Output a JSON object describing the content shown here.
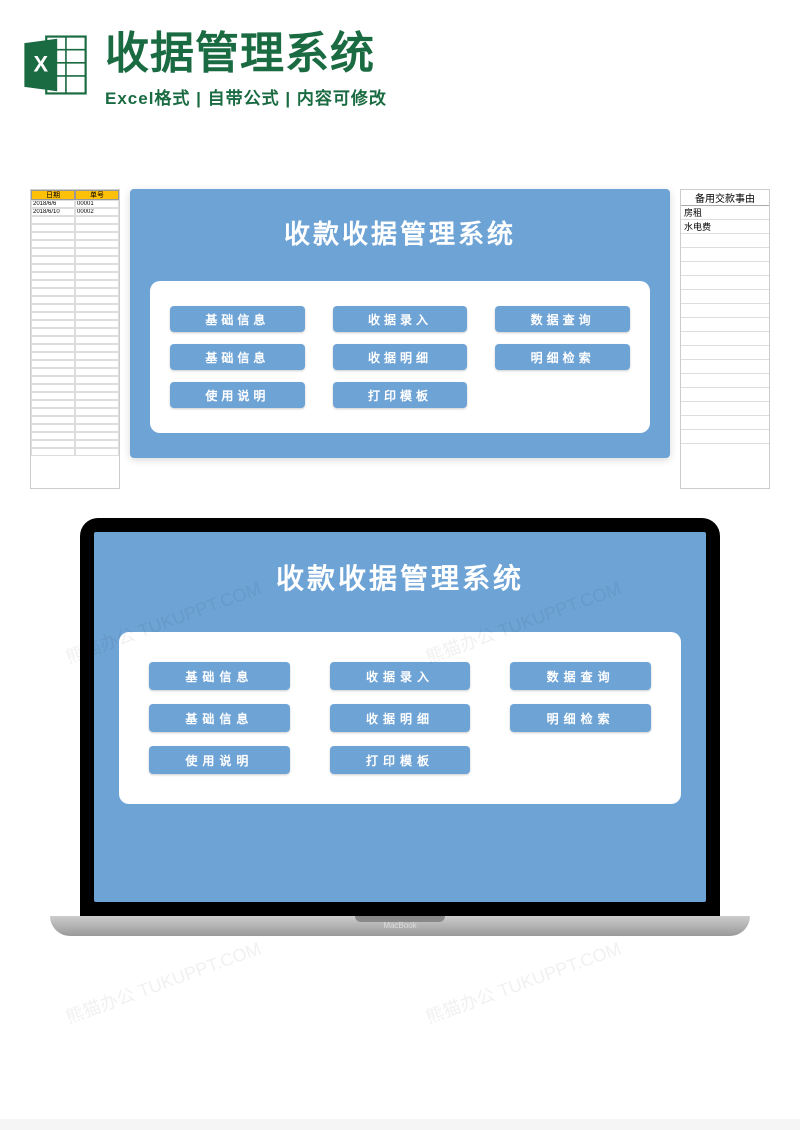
{
  "header": {
    "title": "收据管理系统",
    "subtitle": "Excel格式 | 自带公式 | 内容可修改"
  },
  "panel": {
    "title": "收款收据管理系统",
    "buttons": {
      "r1c1": "基础信息",
      "r1c2": "收据录入",
      "r1c3": "数据查询",
      "r2c1": "基础信息",
      "r2c2": "收据明细",
      "r2c3": "明细检索",
      "r3c1": "使用说明",
      "r3c2": "打印模板"
    }
  },
  "bg_left": {
    "h1": "日期",
    "h2": "单号",
    "d1a": "2018/6/6",
    "d1b": "00001",
    "d2a": "2018/6/10",
    "d2b": "00002"
  },
  "bg_right": {
    "h1": "备用交款事由",
    "d1": "房租",
    "d2": "水电费"
  },
  "laptop": {
    "brand": "MacBook"
  },
  "watermark": "熊猫办公 TUKUPPT.COM"
}
